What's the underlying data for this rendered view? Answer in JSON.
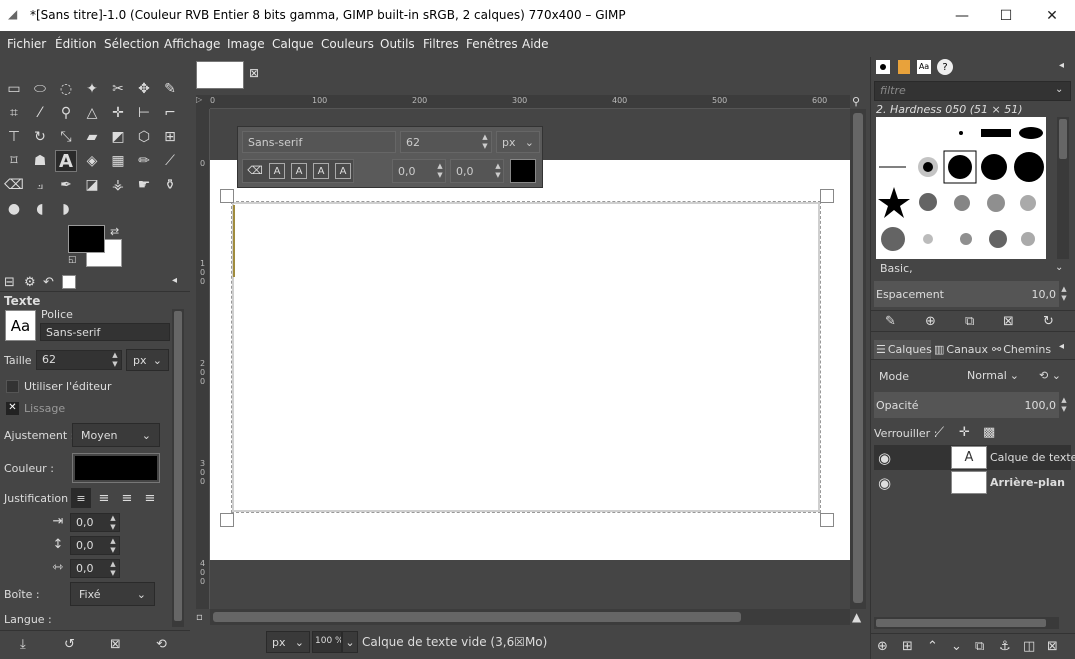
{
  "window": {
    "title": "*[Sans titre]-1.0 (Couleur RVB Entier 8 bits gamma, GIMP built-in sRGB, 2 calques) 770x400 – GIMP",
    "minimize_glyph": "—",
    "maximize_glyph": "☐",
    "close_glyph": "✕"
  },
  "menu": [
    "Fichier",
    "Édition",
    "Sélection",
    "Affichage",
    "Image",
    "Calque",
    "Couleurs",
    "Outils",
    "Filtres",
    "Fenêtres",
    "Aide"
  ],
  "tool_options": {
    "title": "Texte",
    "font_label": "Police",
    "font_value": "Sans-serif",
    "preview": "Aa",
    "size_label": "Taille :",
    "size_value": "62",
    "unit": "px",
    "use_editor": "Utiliser l'éditeur",
    "antialias": "Lissage",
    "hinting_label": "Ajustement :",
    "hinting_value": "Moyen",
    "color_label": "Couleur :",
    "justify_label": "Justification :",
    "indent": "0,0",
    "line_spacing": "0,0",
    "letter_spacing": "0,0",
    "box_label": "Boîte :",
    "box_value": "Fixé",
    "language_label": "Langue :"
  },
  "on_canvas": {
    "font": "Sans-serif",
    "size": "62",
    "unit": "px",
    "baseline": "0,0",
    "kerning": "0,0"
  },
  "ruler": {
    "h_ticks": [
      "0",
      "100",
      "200",
      "300",
      "400",
      "500",
      "600"
    ],
    "v_ticks": [
      "0",
      "1 0 0",
      "2 0 0",
      "3 0 0",
      "4 0 0"
    ]
  },
  "status": {
    "unit": "px",
    "zoom": "100 %",
    "message": "Calque de texte vide (3,6☒Mo)"
  },
  "brushes": {
    "filter_placeholder": "filtre",
    "current": "2. Hardness 050 (51 × 51)",
    "preset": "Basic,",
    "spacing_label": "Espacement",
    "spacing_value": "10,0"
  },
  "layers": {
    "tabs": [
      "Calques",
      "Canaux",
      "Chemins"
    ],
    "mode_label": "Mode",
    "mode_value": "Normal",
    "opacity_label": "Opacité",
    "opacity_value": "100,0",
    "lock_label": "Verrouiller :",
    "items": [
      {
        "name": "Calque de texte",
        "bold": false
      },
      {
        "name": "Arrière-plan",
        "bold": true
      }
    ]
  },
  "colors": {
    "fg": "#000000",
    "bg": "#ffffff",
    "panel": "#454545",
    "dark": "#333333"
  }
}
